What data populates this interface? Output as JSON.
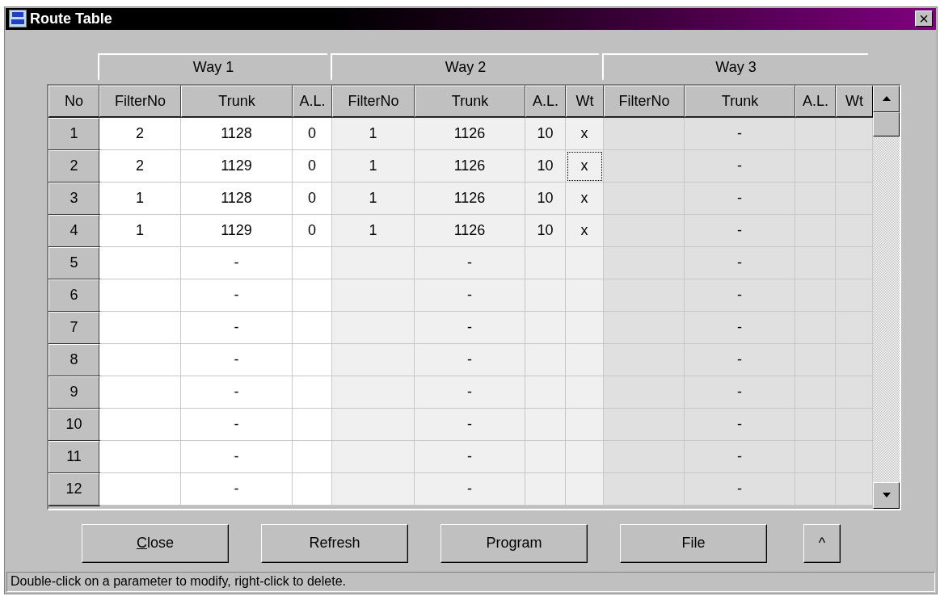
{
  "window": {
    "title": "Route Table",
    "close_glyph": "×"
  },
  "table": {
    "row_header": "No",
    "groups": [
      {
        "label": "Way 1",
        "columns": [
          "FilterNo",
          "Trunk",
          "A.L."
        ]
      },
      {
        "label": "Way 2",
        "columns": [
          "FilterNo",
          "Trunk",
          "A.L.",
          "Wt"
        ]
      },
      {
        "label": "Way 3",
        "columns": [
          "FilterNo",
          "Trunk",
          "A.L.",
          "Wt"
        ]
      }
    ],
    "rows": [
      {
        "cells": [
          "1",
          "2",
          "1128",
          "0",
          "1",
          "1126",
          "10",
          "x",
          "",
          "-",
          "",
          ""
        ],
        "focused_wt": false
      },
      {
        "cells": [
          "2",
          "2",
          "1129",
          "0",
          "1",
          "1126",
          "10",
          "x",
          "",
          "-",
          "",
          ""
        ],
        "focused_wt": true
      },
      {
        "cells": [
          "3",
          "1",
          "1128",
          "0",
          "1",
          "1126",
          "10",
          "x",
          "",
          "-",
          "",
          ""
        ],
        "focused_wt": false
      },
      {
        "cells": [
          "4",
          "1",
          "1129",
          "0",
          "1",
          "1126",
          "10",
          "x",
          "",
          "-",
          "",
          ""
        ],
        "focused_wt": false
      },
      {
        "cells": [
          "5",
          "",
          "-",
          "",
          "",
          "-",
          "",
          "",
          "",
          "-",
          "",
          ""
        ],
        "focused_wt": false
      },
      {
        "cells": [
          "6",
          "",
          "-",
          "",
          "",
          "-",
          "",
          "",
          "",
          "-",
          "",
          ""
        ],
        "focused_wt": false
      },
      {
        "cells": [
          "7",
          "",
          "-",
          "",
          "",
          "-",
          "",
          "",
          "",
          "-",
          "",
          ""
        ],
        "focused_wt": false
      },
      {
        "cells": [
          "8",
          "",
          "-",
          "",
          "",
          "-",
          "",
          "",
          "",
          "-",
          "",
          ""
        ],
        "focused_wt": false
      },
      {
        "cells": [
          "9",
          "",
          "-",
          "",
          "",
          "-",
          "",
          "",
          "",
          "-",
          "",
          ""
        ],
        "focused_wt": false
      },
      {
        "cells": [
          "10",
          "",
          "-",
          "",
          "",
          "-",
          "",
          "",
          "",
          "-",
          "",
          ""
        ],
        "focused_wt": false
      },
      {
        "cells": [
          "11",
          "",
          "-",
          "",
          "",
          "-",
          "",
          "",
          "",
          "-",
          "",
          ""
        ],
        "focused_wt": false
      },
      {
        "cells": [
          "12",
          "",
          "-",
          "",
          "",
          "-",
          "",
          "",
          "",
          "-",
          "",
          ""
        ],
        "focused_wt": false
      }
    ]
  },
  "buttons": [
    {
      "label": "Close",
      "mnemonic": true
    },
    {
      "label": "Refresh",
      "mnemonic": false
    },
    {
      "label": "Program",
      "mnemonic": false
    },
    {
      "label": "File",
      "mnemonic": false
    },
    {
      "label": "^",
      "mnemonic": false,
      "kind": "small"
    }
  ],
  "status_bar": "Double-click on a parameter to modify, right-click to delete."
}
